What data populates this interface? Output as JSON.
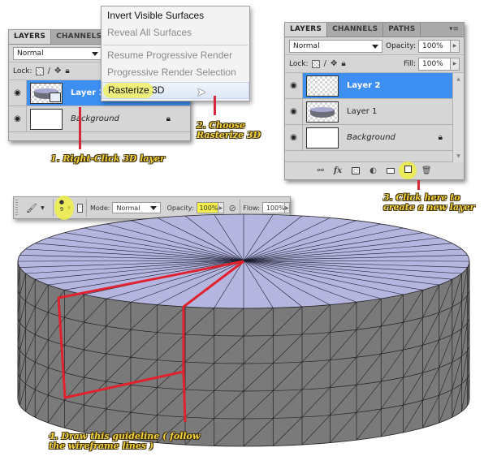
{
  "left_panel": {
    "tabs": [
      "LAYERS",
      "CHANNELS"
    ],
    "blend_mode": "Normal",
    "lock_label": "Lock:",
    "layers": [
      {
        "name": "Layer 1",
        "selected": true,
        "italic": false
      },
      {
        "name": "Background",
        "selected": false,
        "italic": true,
        "locked": true
      }
    ]
  },
  "context_menu": {
    "items": [
      {
        "label": "Invert Visible Surfaces",
        "disabled": false
      },
      {
        "label": "Reveal All Surfaces",
        "disabled": true
      },
      {
        "label": "Resume Progressive Render",
        "disabled": true
      },
      {
        "label": "Progressive Render Selection",
        "disabled": true
      },
      {
        "label": "Rasterize 3D",
        "disabled": false,
        "highlighted": true
      }
    ]
  },
  "right_panel": {
    "tabs": [
      "LAYERS",
      "CHANNELS",
      "PATHS"
    ],
    "blend_mode": "Normal",
    "opacity_label": "Opacity:",
    "opacity_value": "100%",
    "lock_label": "Lock:",
    "fill_label": "Fill:",
    "fill_value": "100%",
    "layers": [
      {
        "name": "Layer 2",
        "selected": true,
        "italic": false
      },
      {
        "name": "Layer 1",
        "selected": false,
        "italic": false
      },
      {
        "name": "Background",
        "selected": false,
        "italic": true,
        "locked": true
      }
    ],
    "footer_icons": [
      "link-icon",
      "fx-icon",
      "mask-icon",
      "adjustment-icon",
      "folder-icon",
      "new-layer-icon",
      "trash-icon"
    ]
  },
  "toolbar": {
    "brush_size": "9",
    "mode_label": "Mode:",
    "mode_value": "Normal",
    "opacity_label": "Opacity:",
    "opacity_value": "100%",
    "flow_label": "Flow:",
    "flow_value": "100%"
  },
  "annotations": {
    "step1": "1. Right-Click 3D layer",
    "step2_line1": "2. Choose",
    "step2_line2": "Rasterize 3D",
    "step3_line1": "3. Click here to",
    "step3_line2": "create a new layer",
    "step4_line1": "4. Draw this guideline ( follow",
    "step4_line2": "the wireframe lines )"
  },
  "colors": {
    "selection_blue": "#3d8ff2",
    "annotation_yellow": "#f3d23a",
    "pointer_red": "#d8273a",
    "cylinder_top": "#b4b6e0",
    "cylinder_side": "#7a7a7a",
    "guide_red": "#e0222e"
  }
}
